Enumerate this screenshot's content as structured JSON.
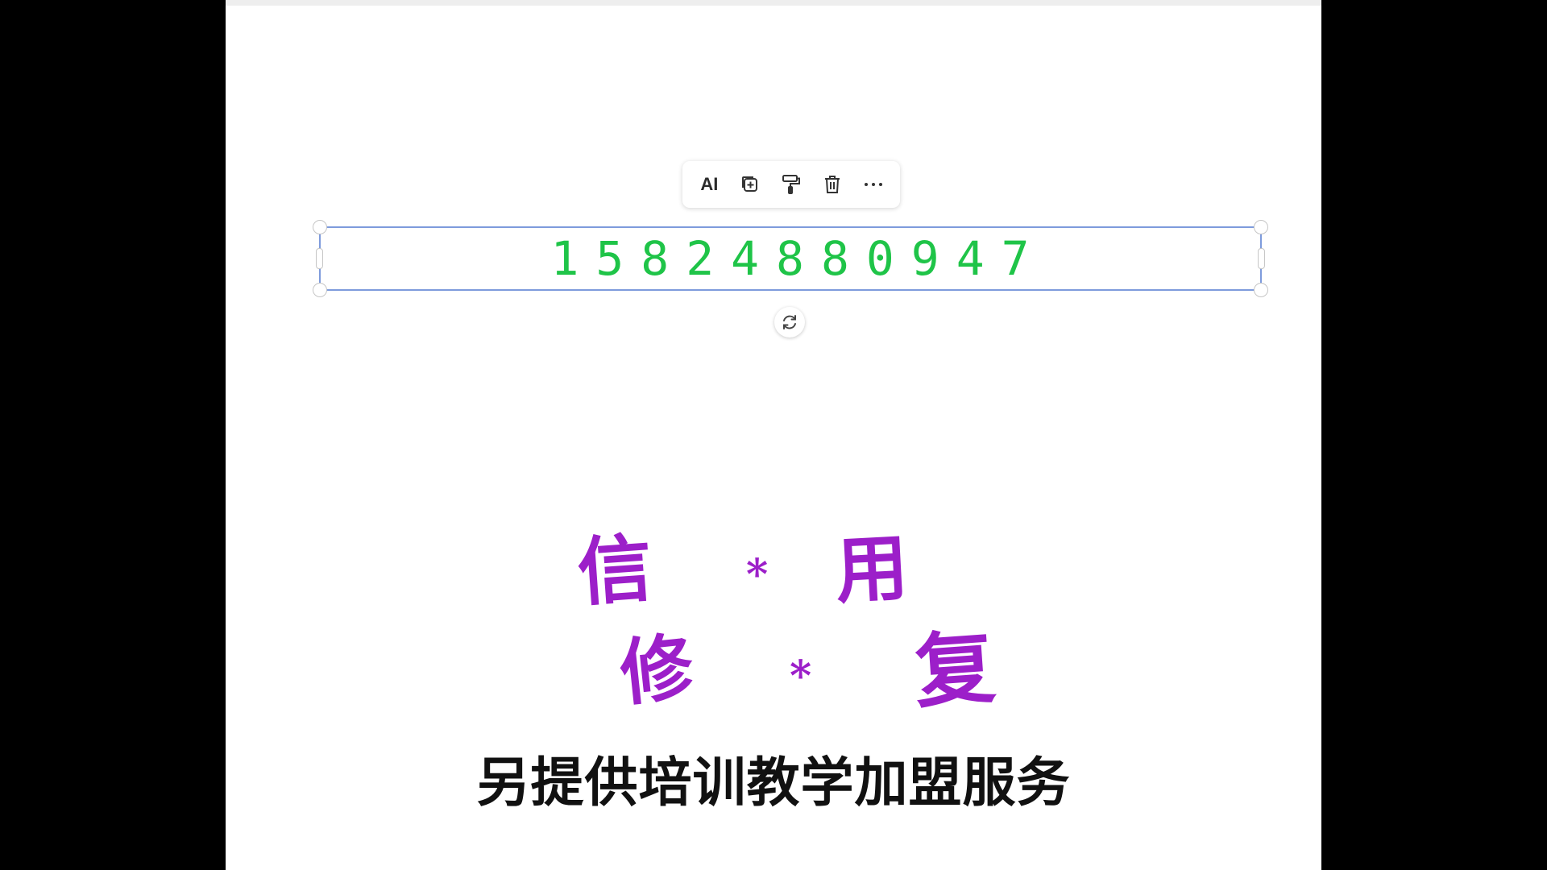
{
  "toolbar": {
    "ai_label": "AI",
    "buttons": [
      {
        "icon": "copy-add-icon"
      },
      {
        "icon": "format-painter-icon"
      },
      {
        "icon": "trash-icon"
      },
      {
        "icon": "more-icon"
      }
    ]
  },
  "textbox": {
    "text": "15824880947",
    "color": "#1fc448"
  },
  "rotate": {
    "icon": "rotate-icon"
  },
  "calligraphy": {
    "line1": {
      "char1": "信",
      "sep": "*",
      "char2": "用"
    },
    "line2": {
      "char1": "修",
      "sep": "*",
      "char2": "复"
    },
    "color": "#9c1fc9"
  },
  "subtitle": "另提供培训教学加盟服务"
}
